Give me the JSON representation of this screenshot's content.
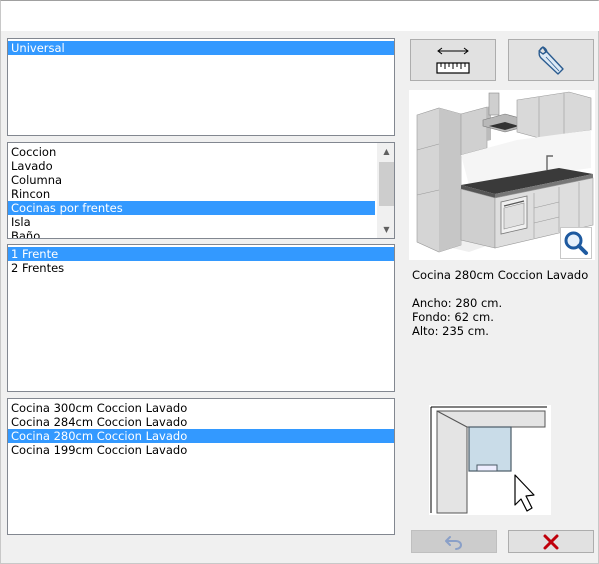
{
  "list_tipo": {
    "items": [
      {
        "label": "Universal",
        "selected": true
      }
    ]
  },
  "list_categoria": {
    "items": [
      {
        "label": "Coccion",
        "selected": false
      },
      {
        "label": "Lavado",
        "selected": false
      },
      {
        "label": "Columna",
        "selected": false
      },
      {
        "label": "Rincon",
        "selected": false
      },
      {
        "label": "Cocinas por frentes",
        "selected": true
      },
      {
        "label": "Isla",
        "selected": false
      },
      {
        "label": "Baño",
        "selected": false
      }
    ]
  },
  "list_frentes": {
    "items": [
      {
        "label": "1 Frente",
        "selected": true
      },
      {
        "label": "2 Frentes",
        "selected": false
      }
    ]
  },
  "list_modelos": {
    "items": [
      {
        "label": "Cocina 300cm Coccion Lavado",
        "selected": false
      },
      {
        "label": "Cocina 284cm Coccion Lavado",
        "selected": false
      },
      {
        "label": "Cocina 280cm Coccion Lavado",
        "selected": true
      },
      {
        "label": "Cocina 199cm Coccion Lavado",
        "selected": false
      }
    ]
  },
  "details": {
    "title": "Cocina 280cm Coccion Lavado",
    "ancho": "Ancho: 280 cm.",
    "fondo": "Fondo: 62 cm.",
    "alto": "Alto: 235 cm."
  },
  "icons": {
    "measure": "ruler-width-icon",
    "tools": "wrench-icon",
    "zoom": "magnifier-icon",
    "undo": "undo-arrow-icon",
    "close": "red-x-icon"
  },
  "colors": {
    "selection": "#3399ff",
    "close_x": "#c0000b",
    "zoom": "#1e5aa0"
  }
}
